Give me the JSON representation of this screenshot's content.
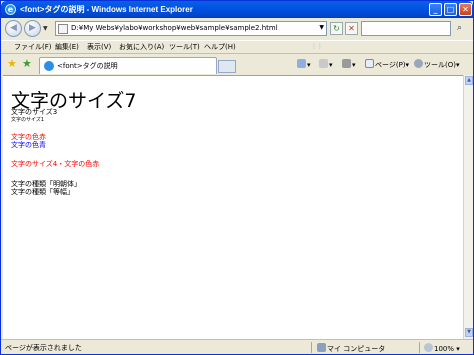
{
  "window": {
    "title": "<font>タグの説明 - Windows Internet Explorer",
    "minimize": "_",
    "maximize": "□",
    "close": "✕"
  },
  "address": {
    "url": "D:¥My Webs¥ylabo¥workshop¥web¥sample¥sample2.html",
    "search_placeholder": ""
  },
  "menu": [
    "ファイル(F)",
    "編集(E)",
    "表示(V)",
    "お気に入り(A)",
    "ツール(T)",
    "ヘルプ(H)"
  ],
  "tab": {
    "label": "<font>タグの説明"
  },
  "tools": {
    "page": "ページ(P)",
    "tools": "ツール(O)"
  },
  "content": {
    "size7": "文字のサイズ7",
    "size3": "文字のサイズ3",
    "size1": "文字のサイズ1",
    "color_red": "文字の色赤",
    "color_blue": "文字の色青",
    "size4_red": "文字のサイズ4・文字の色赤",
    "face_mincho": "文字の種類「明朝体」",
    "face_tohaba": "文字の種類「等幅」"
  },
  "status": {
    "text": "ページが表示されました",
    "zone": "マイ コンピュータ",
    "zoom": "100%"
  },
  "colors": {
    "red": "#ff0000",
    "blue": "#0000ff",
    "titlebar": "#0054e3"
  },
  "icons": [
    "ie-icon",
    "back-icon",
    "forward-icon",
    "refresh-icon",
    "stop-icon",
    "search-icon",
    "favorites-star-icon",
    "add-favorites-icon",
    "home-icon",
    "feeds-icon",
    "print-icon",
    "page-icon",
    "tools-icon"
  ]
}
